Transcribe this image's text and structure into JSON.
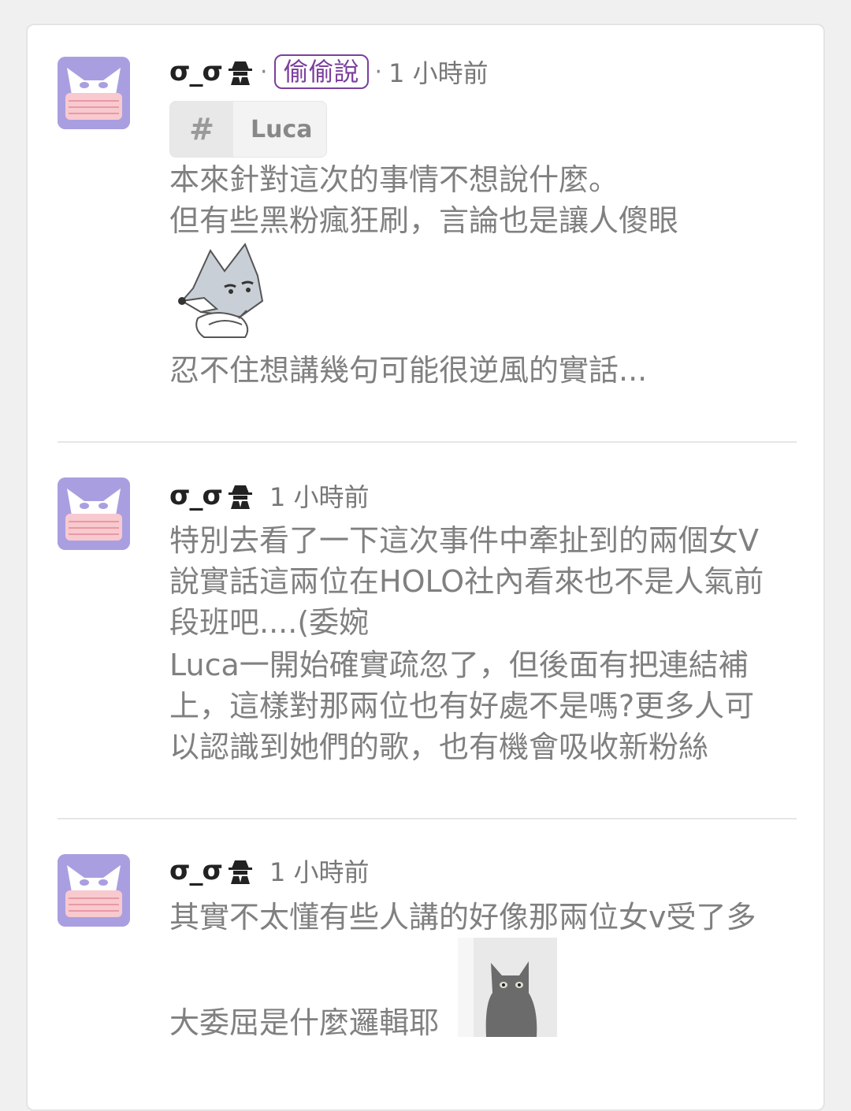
{
  "colors": {
    "accent": "#7b3f9e",
    "avatar_bg": "#a99fe0",
    "text": "#808080"
  },
  "posts": [
    {
      "username": " σ_σ",
      "user_icon": "spy-icon",
      "badge": "偷偷說",
      "time": "1 小時前",
      "tag": {
        "hash": "#",
        "label": "Luca"
      },
      "lines": [
        "本來針對這次的事情不想說什麼。",
        "但有些黑粉瘋狂刷，言論也是讓人傻眼"
      ],
      "sticker": "fox-arms-crossed-sticker",
      "after_lines": [
        "忍不住想講幾句可能很逆風的實話..."
      ]
    },
    {
      "username": "σ_σ",
      "user_icon": "spy-icon",
      "time": "1 小時前",
      "lines": [
        "特別去看了一下這次事件中牽扯到的兩個女V",
        "說實話這兩位在HOLO社內看來也不是人氣前",
        "段班吧....(委婉",
        "Luca一開始確實疏忽了，但後面有把連結補",
        "上，這樣對那兩位也有好處不是嗎?更多人可",
        "以認識到她們的歌，也有機會吸收新粉絲"
      ]
    },
    {
      "username": "σ_σ",
      "user_icon": "spy-icon",
      "time": "1 小時前",
      "lines": [
        "其實不太懂有些人講的好像那兩位女v受了多",
        "大委屈是什麼邏輯耶"
      ],
      "sticker": "black-cat-sticker"
    }
  ]
}
